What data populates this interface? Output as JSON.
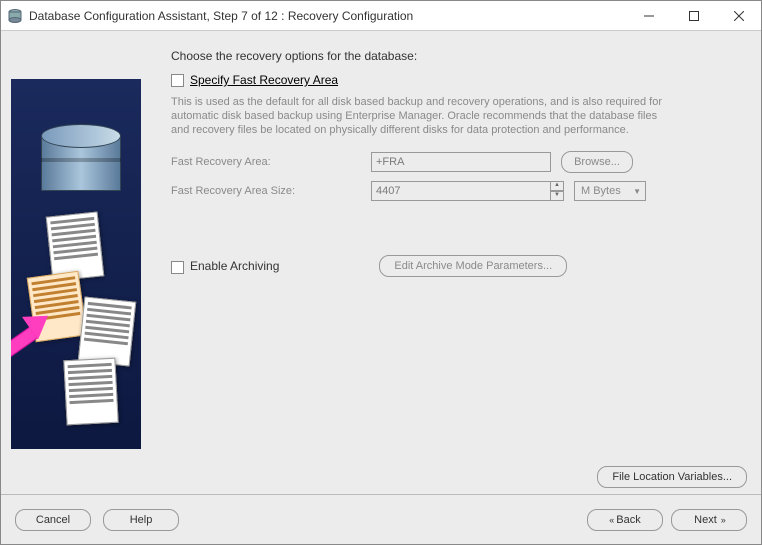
{
  "window": {
    "title": "Database Configuration Assistant, Step 7 of 12 : Recovery Configuration"
  },
  "main": {
    "heading": "Choose the recovery options for the database:",
    "recovery": {
      "checkbox_label": "Specify Fast Recovery Area",
      "description": "This is used as the default for all disk based backup and recovery operations, and is also required for automatic disk based backup using Enterprise Manager. Oracle recommends that the database files and recovery files be located on physically different disks for data protection and performance.",
      "area_label": "Fast Recovery Area:",
      "area_value": "+FRA",
      "browse_label": "Browse...",
      "size_label": "Fast Recovery Area Size:",
      "size_value": "4407",
      "size_unit": "M Bytes"
    },
    "archiving": {
      "checkbox_label": "Enable Archiving",
      "edit_button": "Edit Archive Mode Parameters..."
    },
    "file_locations_button": "File Location Variables..."
  },
  "footer": {
    "cancel": "Cancel",
    "help": "Help",
    "back": "Back",
    "next": "Next"
  }
}
